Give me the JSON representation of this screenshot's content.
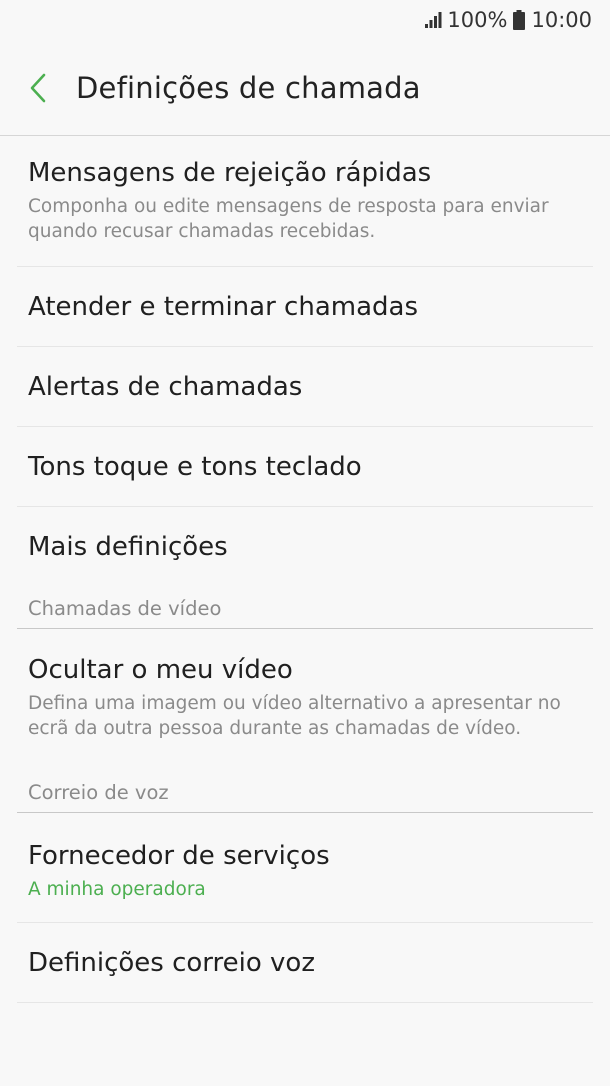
{
  "status_bar": {
    "battery": "100%",
    "time": "10:00",
    "icons": [
      "signal-icon",
      "battery-icon"
    ]
  },
  "header": {
    "title": "Definições de chamada",
    "back_icon": "chevron-left-icon",
    "accent_color": "#4caf50"
  },
  "items": [
    {
      "title": "Mensagens de rejeição rápidas",
      "summary": "Componha ou edite mensagens de resposta para enviar quando recusar chamadas recebidas."
    },
    {
      "title": "Atender e terminar chamadas"
    },
    {
      "title": "Alertas de chamadas"
    },
    {
      "title": "Tons toque e tons teclado"
    },
    {
      "title": "Mais definições"
    }
  ],
  "video_section": {
    "header": "Chamadas de vídeo",
    "items": [
      {
        "title": "Ocultar o meu vídeo",
        "summary": "Defina uma imagem ou vídeo alternativo a apresentar no ecrã da outra pessoa durante as chamadas de vídeo."
      }
    ]
  },
  "voicemail_section": {
    "header": "Correio de voz",
    "items": [
      {
        "title": "Fornecedor de serviços",
        "summary": "A minha operadora"
      },
      {
        "title": "Definições correio voz"
      }
    ]
  }
}
